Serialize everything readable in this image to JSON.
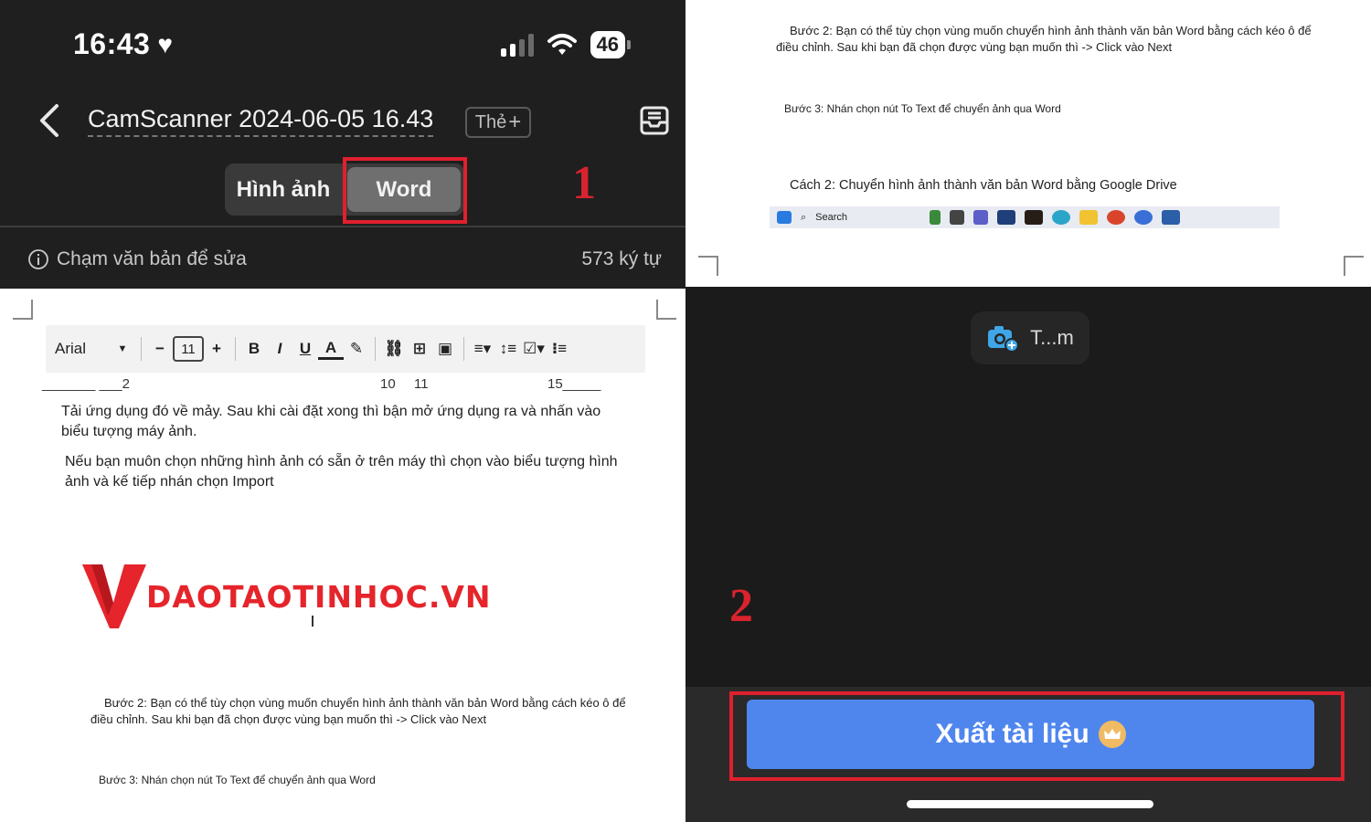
{
  "status_bar": {
    "time": "16:43",
    "battery": "46"
  },
  "header": {
    "title": "CamScanner 2024-06-05 16.43",
    "tag_label": "Thẻ",
    "tabs": [
      {
        "label": "Hình ảnh",
        "selected": false
      },
      {
        "label": "Word",
        "selected": true
      }
    ]
  },
  "info_bar": {
    "hint": "Chạm văn bản để sửa",
    "char_count": "573 ký tự"
  },
  "annotations": {
    "step1": "1",
    "step2": "2",
    "highlight_color": "#e0202e"
  },
  "doc_left": {
    "toolbar": {
      "font": "Arial",
      "font_size": "11",
      "bold": "B",
      "italic": "I",
      "underline": "U",
      "text_color": "A"
    },
    "ruler": {
      "left": "_______ ___2",
      "mark_10": "10",
      "mark_11": "11",
      "mark_15": "15_____"
    },
    "para1": "Tải ứng dụng đó về mảy. Sau khi cài đặt xong thì bận mở ứng dụng ra và nhấn vào biểu tượng máy ảnh.",
    "para2": "Nếu bạn muôn chọn những hình ảnh có sẵn ở trên máy thì chọn vào biểu tượng hình ảnh và kế tiếp nhán chọn Import",
    "logo_text": "DAOTAOTINHOC.VN",
    "step2": "Bước 2: Bạn có thể tùy chọn vùng muốn chuyển hình ảnh thành văn bản Word bằng cách kéo ô để điều chỉnh. Sau khi bạn đã chọn được vùng bạn muốn thì -> Click vào Next",
    "step3": "Bước 3: Nhán chọn nút To Text để chuyển ảnh qua Word"
  },
  "doc_right": {
    "step2": "Bước 2: Bạn có thể tùy chọn vùng muốn chuyển hình ảnh thành văn bản Word bằng cách kéo ô để điều chỉnh. Sau khi bạn đã chọn được vùng bạn muốn thì -> Click vào Next",
    "step3": "Bước 3: Nhán chọn nút To Text để chuyển ảnh qua Word",
    "heading": "Cách 2: Chuyển hình ảnh thành văn bản Word bằng Google Drive",
    "taskbar_search": "Search"
  },
  "bottom": {
    "camera_pill": "T...m",
    "export_button": "Xuất tài liệu",
    "accent": "#4f86ee"
  }
}
